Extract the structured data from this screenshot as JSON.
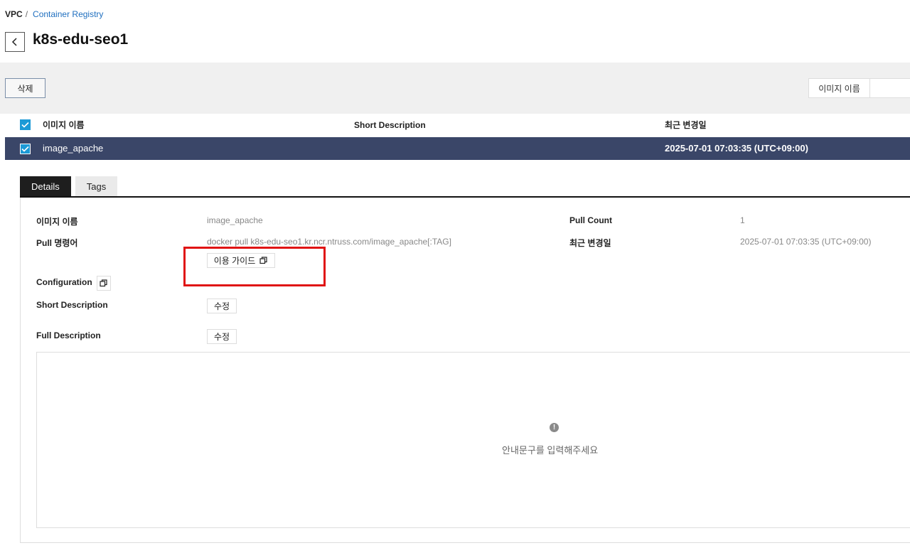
{
  "breadcrumb": {
    "root": "VPC",
    "separator": "/",
    "link": "Container Registry"
  },
  "page_title": "k8s-edu-seo1",
  "toolbar": {
    "delete_label": "삭제",
    "search_select": "이미지 이름",
    "search_value": ""
  },
  "table": {
    "headers": {
      "name": "이미지 이름",
      "short_desc": "Short Description",
      "modified": "최근 변경일"
    },
    "rows": [
      {
        "name": "image_apache",
        "short_desc": "",
        "modified": "2025-07-01 07:03:35 (UTC+09:00)",
        "checked": true
      }
    ],
    "all_checked": true
  },
  "tabs": [
    {
      "label": "Details",
      "active": true
    },
    {
      "label": "Tags",
      "active": false
    }
  ],
  "details": {
    "image_name_label": "이미지 이름",
    "image_name_value": "image_apache",
    "pull_cmd_label": "Pull 명령어",
    "pull_cmd_value": "docker pull k8s-edu-seo1.kr.ncr.ntruss.com/image_apache[:TAG]",
    "usage_guide_label": "이용 가이드",
    "configuration_label": "Configuration",
    "short_desc_label": "Short Description",
    "full_desc_label": "Full Description",
    "edit_label": "수정",
    "pull_count_label": "Pull Count",
    "pull_count_value": "1",
    "modified_label": "최근 변경일",
    "modified_value": "2025-07-01 07:03:35 (UTC+09:00)",
    "full_desc_placeholder": "안내문구를 입력해주세요",
    "info_glyph": "!"
  },
  "colors": {
    "selected_row": "#3a4668",
    "checkbox": "#1c9ad6",
    "highlight": "#e01414",
    "link": "#1f6fbf"
  }
}
